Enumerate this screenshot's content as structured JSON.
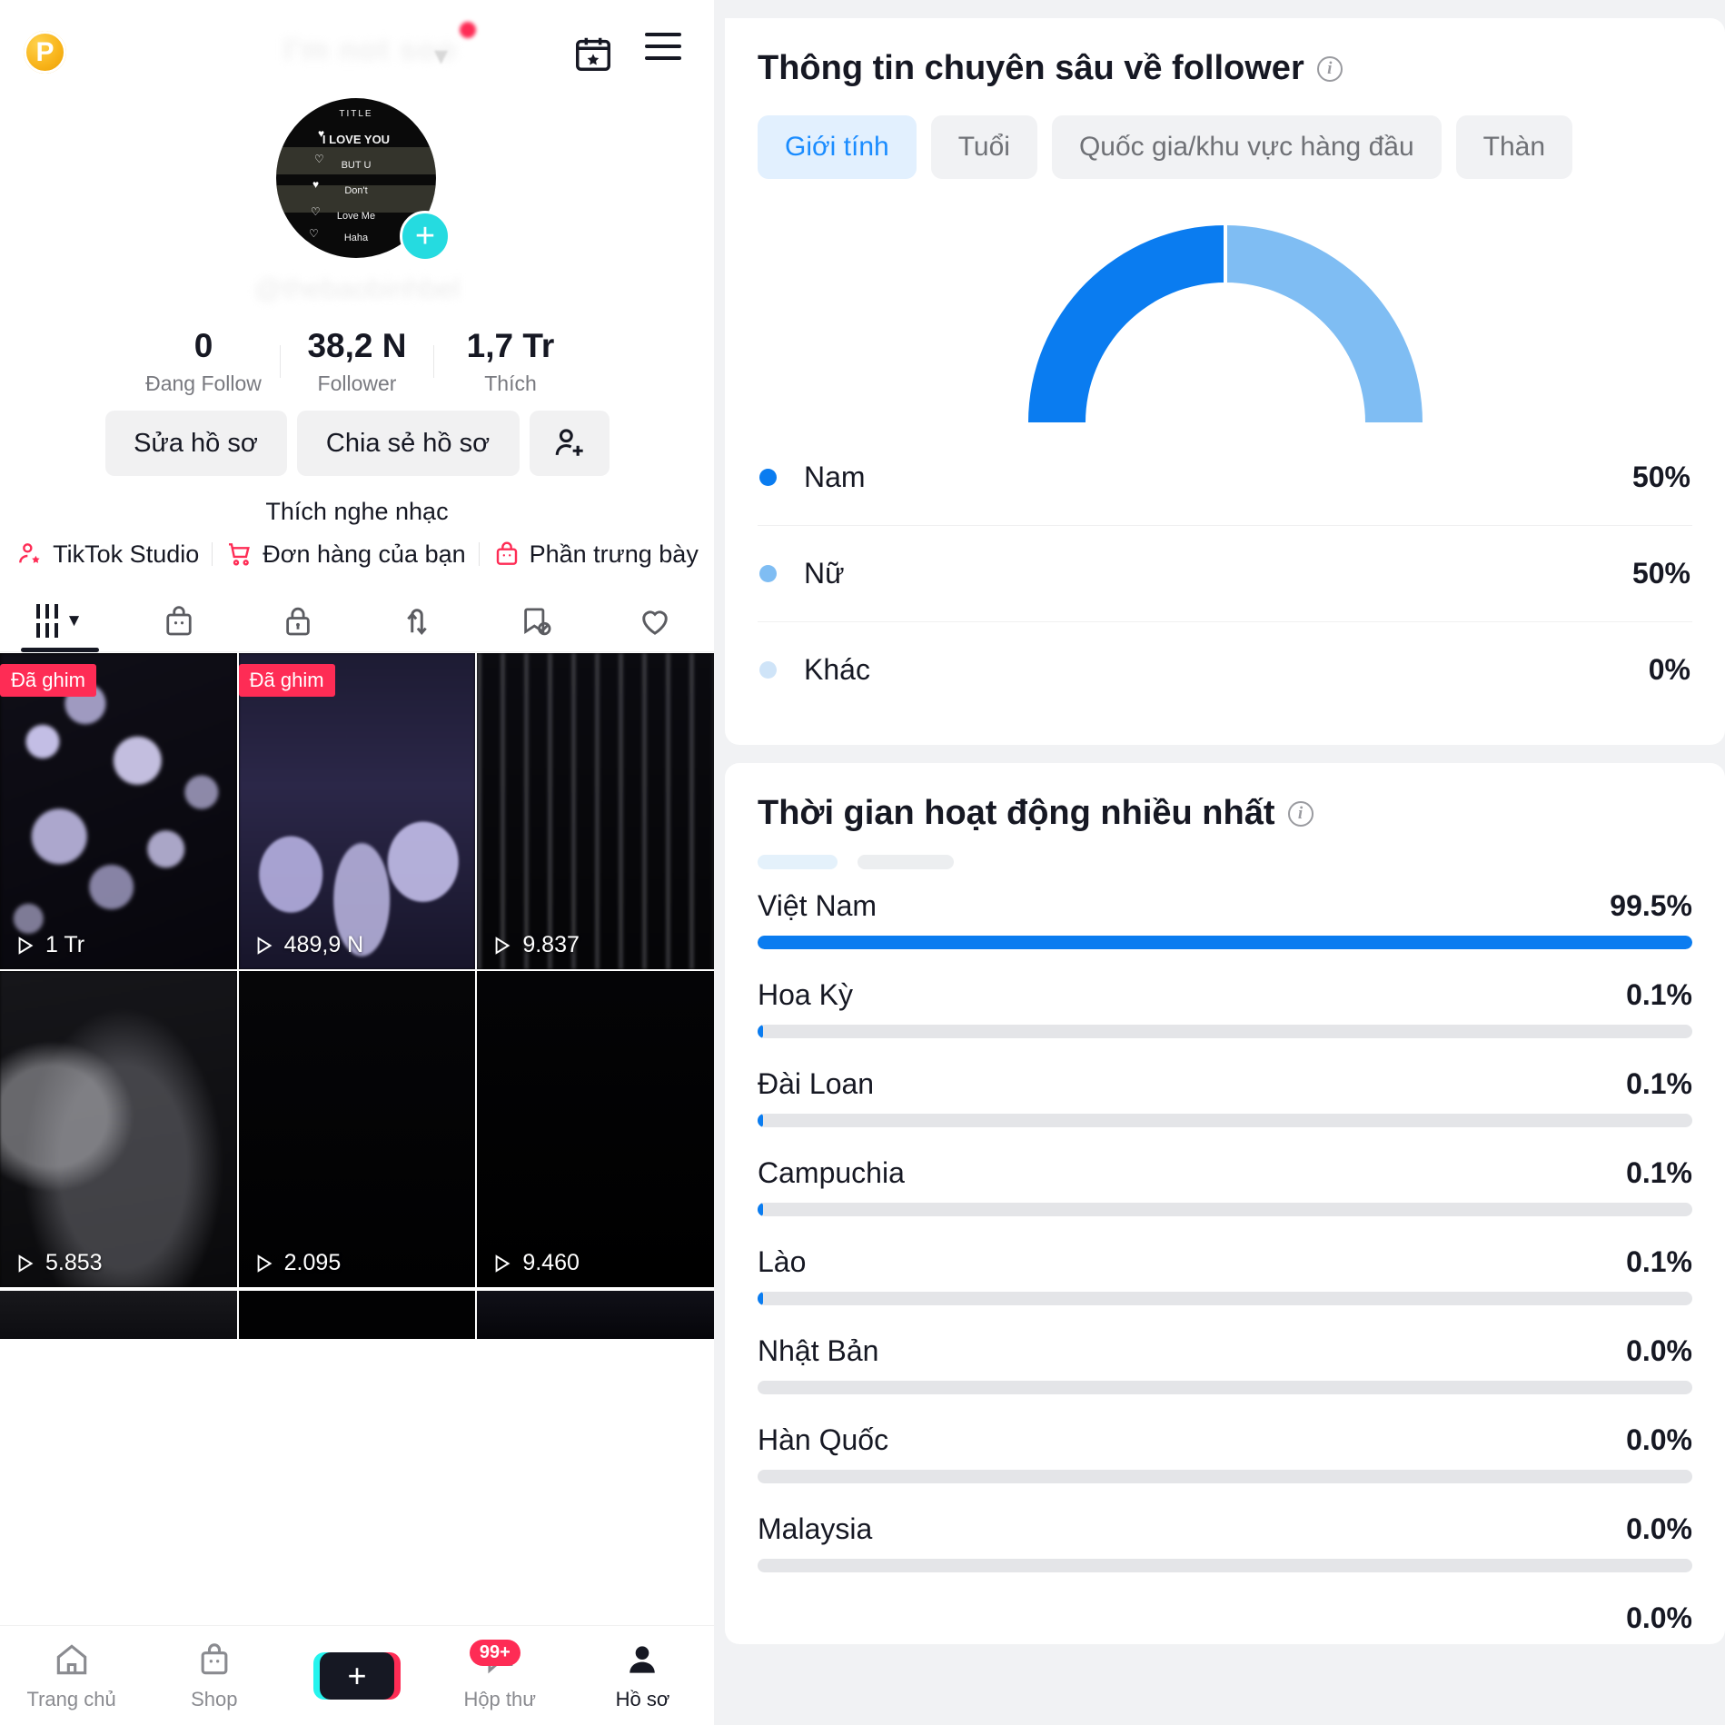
{
  "profile": {
    "coin_label": "P",
    "username_top": "I'm not soo",
    "handle": "@thebaobinhbel",
    "avatar": {
      "title": "TITLE",
      "lines": [
        "I LOVE YOU",
        "BUT U",
        "Don't",
        "Love Me",
        "Haha"
      ]
    },
    "stats": [
      {
        "value": "0",
        "label": "Đang Follow"
      },
      {
        "value": "38,2 N",
        "label": "Follower"
      },
      {
        "value": "1,7 Tr",
        "label": "Thích"
      }
    ],
    "actions": {
      "edit": "Sửa hồ sơ",
      "share": "Chia sẻ hồ sơ",
      "add_user_icon": "add-user-icon"
    },
    "bio": "Thích nghe nhạc",
    "links": [
      {
        "icon": "studio-icon",
        "label": "TikTok Studio"
      },
      {
        "icon": "cart-icon",
        "label": "Đơn hàng của bạn"
      },
      {
        "icon": "shopbag-icon",
        "label": "Phần trưng bày"
      }
    ],
    "tabs": [
      {
        "icon": "grid-icon",
        "name": "tab-posts",
        "active": true
      },
      {
        "icon": "shopping-bag-icon",
        "name": "tab-shop",
        "active": false
      },
      {
        "icon": "lock-icon",
        "name": "tab-private",
        "active": false
      },
      {
        "icon": "repost-icon",
        "name": "tab-repost",
        "active": false
      },
      {
        "icon": "bookmark-hidden-icon",
        "name": "tab-saved",
        "active": false
      },
      {
        "icon": "heart-icon",
        "name": "tab-liked",
        "active": false
      }
    ],
    "videos": [
      {
        "views": "1 Tr",
        "pinned_label": "Đã ghim",
        "pinned": true,
        "thumb": "th-bokeh"
      },
      {
        "views": "489,9 N",
        "pinned_label": "Đã ghim",
        "pinned": true,
        "thumb": "th-city"
      },
      {
        "views": "9.837",
        "pinned": false,
        "thumb": "th-dark1"
      },
      {
        "views": "5.853",
        "pinned": false,
        "thumb": "th-desk"
      },
      {
        "views": "2.095",
        "pinned": false,
        "thumb": "th-black"
      },
      {
        "views": "9.460",
        "pinned": false,
        "thumb": "th-black2"
      }
    ],
    "navbar": [
      {
        "icon": "home-icon",
        "label": "Trang chủ",
        "active": false
      },
      {
        "icon": "shop-icon",
        "label": "Shop",
        "active": false
      },
      {
        "icon": "create-icon",
        "label": "",
        "active": false
      },
      {
        "icon": "inbox-icon",
        "label": "Hộp thư",
        "badge": "99+",
        "active": false
      },
      {
        "icon": "profile-icon",
        "label": "Hồ sơ",
        "active": true
      }
    ]
  },
  "analytics": {
    "follower_card": {
      "title": "Thông tin chuyên sâu về follower",
      "info_icon": "info-icon",
      "chips": [
        {
          "label": "Giới tính",
          "active": true
        },
        {
          "label": "Tuổi",
          "active": false
        },
        {
          "label": "Quốc gia/khu vực hàng đầu",
          "active": false
        },
        {
          "label": "Thàn",
          "active": false
        }
      ]
    },
    "activity_card": {
      "title": "Thời gian hoạt động nhiều nhất",
      "info_icon": "info-icon"
    },
    "colors": {
      "male": "#0a7cf0",
      "female": "#7fbdf3",
      "other": "#cfe4f8",
      "bar": "#0a7cf0",
      "track": "#e4e5e8",
      "accent": "#1a8cff"
    }
  },
  "chart_data": [
    {
      "type": "pie",
      "title": "Thông tin chuyên sâu về follower",
      "subtype": "semi-donut-gauge",
      "categories": [
        "Nam",
        "Nữ",
        "Khác"
      ],
      "values": [
        50,
        50,
        0
      ],
      "value_labels": [
        "50%",
        "50%",
        "0%"
      ],
      "colors": [
        "#0a7cf0",
        "#7fbdf3",
        "#cfe4f8"
      ],
      "legend": "bottom-list",
      "unit": "%"
    },
    {
      "type": "bar",
      "orientation": "horizontal",
      "title": "Thời gian hoạt động nhiều nhất",
      "categories": [
        "Việt Nam",
        "Hoa Kỳ",
        "Đài Loan",
        "Campuchia",
        "Lào",
        "Nhật Bản",
        "Hàn Quốc",
        "Malaysia",
        ""
      ],
      "values": [
        99.5,
        0.1,
        0.1,
        0.1,
        0.1,
        0.0,
        0.0,
        0.0,
        0.0
      ],
      "value_labels": [
        "99.5%",
        "0.1%",
        "0.1%",
        "0.1%",
        "0.1%",
        "0.0%",
        "0.0%",
        "0.0%",
        "0.0%"
      ],
      "xlabel": "",
      "ylabel": "",
      "xlim": [
        0,
        100
      ],
      "grid": false,
      "bar_color": "#0a7cf0",
      "track_color": "#e4e5e8"
    }
  ]
}
